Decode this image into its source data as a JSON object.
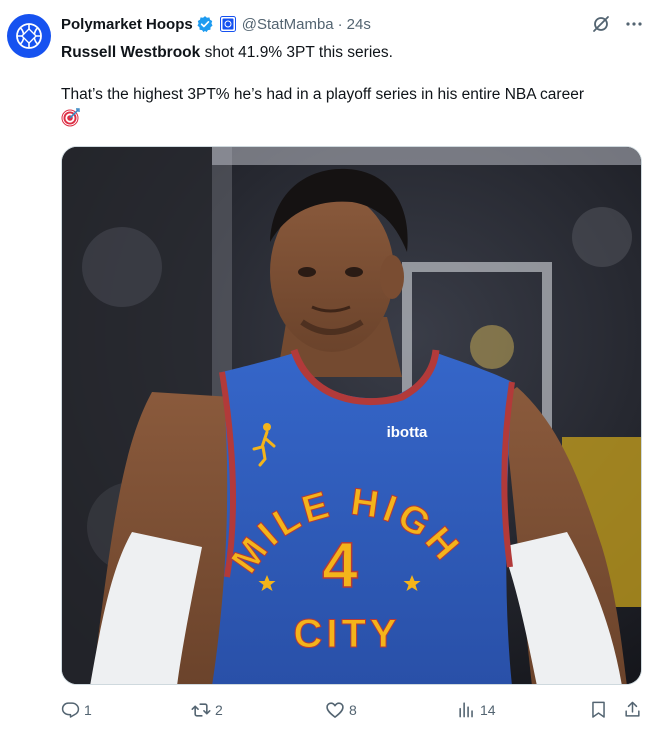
{
  "tweet": {
    "author_name": "Polymarket Hoops",
    "handle": "@StatMamba",
    "separator": "·",
    "time": "24s",
    "text_bold": "Russell Westbrook",
    "text_rest": " shot 41.9% 3PT this series.",
    "text_line2": "That’s the highest 3PT% he’s had in a playoff series in his entire NBA career",
    "emoji_icon": "direct-hit-emoji",
    "media": {
      "jersey_wordmark_top": "MILE HIGH",
      "jersey_number": "4",
      "jersey_wordmark_bottom": "CITY",
      "jersey_sponsor": "ibotta"
    }
  },
  "actions": {
    "reply_count": "1",
    "retweet_count": "2",
    "like_count": "8",
    "views_count": "14"
  },
  "colors": {
    "accent_blue": "#1d9bf0",
    "avatar_bg": "#1652f0",
    "muted_text": "#536471",
    "jersey_blue": "#2f5fc4",
    "jersey_gold": "#f4b41a",
    "jersey_red": "#b23a3a"
  }
}
